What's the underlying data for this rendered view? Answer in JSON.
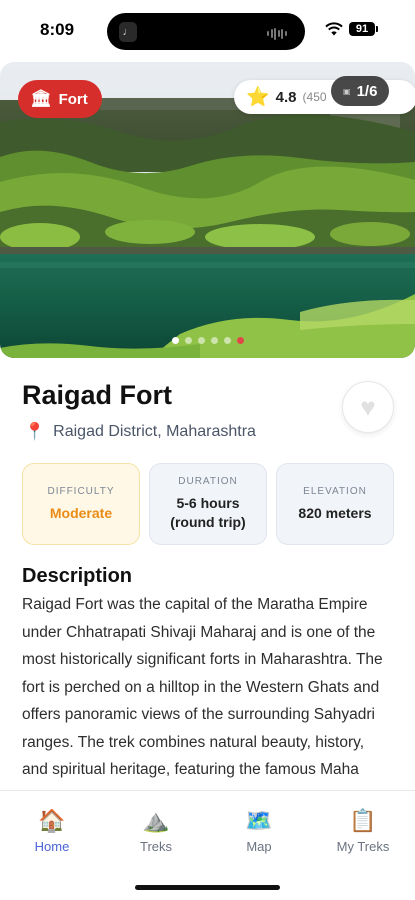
{
  "status": {
    "time": "8:09",
    "battery": "91"
  },
  "hero": {
    "category": "Fort",
    "rating": "4.8",
    "rating_count": "(450",
    "photo_counter": "1/6",
    "dots_count": 6
  },
  "trek": {
    "name": "Raigad Fort",
    "location": "Raigad District, Maharashtra"
  },
  "stats": {
    "difficulty_label": "DIFFICULTY",
    "difficulty_value": "Moderate",
    "duration_label": "DURATION",
    "duration_value_line1": "5-6 hours",
    "duration_value_line2": "(round trip)",
    "elevation_label": "ELEVATION",
    "elevation_value": "820 meters"
  },
  "description": {
    "heading": "Description",
    "text": "Raigad Fort was the capital of the Maratha Empire under Chhatrapati Shivaji Maharaj and is one of the most historically significant forts in Maharashtra. The fort is perched on a hilltop in the Western Ghats and offers panoramic views of the surrounding Sahyadri ranges. The trek combines natural beauty, history, and spiritual heritage, featuring the famous Maha Darwaja"
  },
  "nav": [
    {
      "label": "Home",
      "icon": "house-icon",
      "glyph": "🏠",
      "active": true
    },
    {
      "label": "Treks",
      "icon": "mountain-icon",
      "glyph": "⛰️",
      "active": false
    },
    {
      "label": "Map",
      "icon": "map-icon",
      "glyph": "🗺️",
      "active": false
    },
    {
      "label": "My Treks",
      "icon": "clipboard-icon",
      "glyph": "📋",
      "active": false
    }
  ],
  "colors": {
    "accent": "#4a63d6",
    "category_chip": "#d62f2b",
    "difficulty": "#e98b15"
  }
}
